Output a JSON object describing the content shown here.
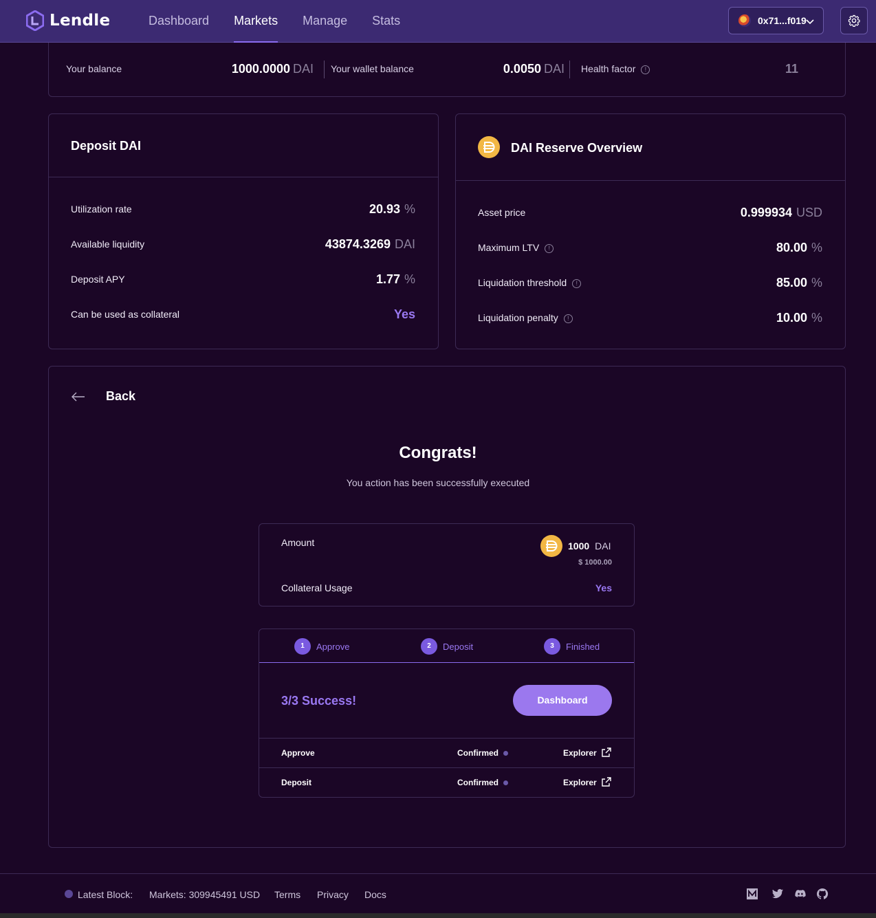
{
  "brand": {
    "name": "Lendle"
  },
  "nav": {
    "items": [
      "Dashboard",
      "Markets",
      "Manage",
      "Stats"
    ],
    "active": "Markets"
  },
  "wallet": {
    "address": "0x71...f019"
  },
  "balances": {
    "your_balance_label": "Your balance",
    "your_balance_value": "1000.0000",
    "your_balance_unit": "DAI",
    "wallet_balance_label": "Your wallet balance",
    "wallet_balance_value": "0.0050",
    "wallet_balance_unit": "DAI",
    "health_label": "Health factor",
    "health_value": "11"
  },
  "deposit_card": {
    "title": "Deposit DAI",
    "rows": [
      {
        "label": "Utilization rate",
        "value": "20.93",
        "unit": "%"
      },
      {
        "label": "Available liquidity",
        "value": "43874.3269",
        "unit": "DAI"
      },
      {
        "label": "Deposit APY",
        "value": "1.77",
        "unit": "%"
      },
      {
        "label": "Can be used as collateral",
        "value": "Yes",
        "unit": ""
      }
    ]
  },
  "reserve_card": {
    "title": "DAI Reserve Overview",
    "rows": [
      {
        "label": "Asset price",
        "value": "0.999934",
        "unit": "USD"
      },
      {
        "label": "Maximum LTV",
        "value": "80.00",
        "unit": "%"
      },
      {
        "label": "Liquidation threshold",
        "value": "85.00",
        "unit": "%"
      },
      {
        "label": "Liquidation penalty",
        "value": "10.00",
        "unit": "%"
      }
    ]
  },
  "action": {
    "back_label": "Back",
    "title": "Congrats!",
    "subtitle": "You action has been successfully executed",
    "amount_label": "Amount",
    "amount_value": "1000",
    "amount_unit": "DAI",
    "amount_usd": "$ 1000.00",
    "collateral_label": "Collateral Usage",
    "collateral_value": "Yes",
    "steps": [
      {
        "num": "1",
        "label": "Approve"
      },
      {
        "num": "2",
        "label": "Deposit"
      },
      {
        "num": "3",
        "label": "Finished"
      }
    ],
    "success_text": "3/3 Success!",
    "dashboard_button": "Dashboard",
    "transactions": [
      {
        "name": "Approve",
        "status": "Confirmed",
        "link": "Explorer"
      },
      {
        "name": "Deposit",
        "status": "Confirmed",
        "link": "Explorer"
      }
    ]
  },
  "footer": {
    "latest_block_label": "Latest Block:",
    "markets": "Markets: 309945491 USD",
    "links": [
      "Terms",
      "Privacy",
      "Docs"
    ],
    "socials": [
      "medium-icon",
      "twitter-icon",
      "discord-icon",
      "github-icon"
    ]
  },
  "colors": {
    "background": "#1b0626",
    "navbar": "#3c2a72",
    "accent": "#9a78f2",
    "dai": "#f2b744"
  }
}
